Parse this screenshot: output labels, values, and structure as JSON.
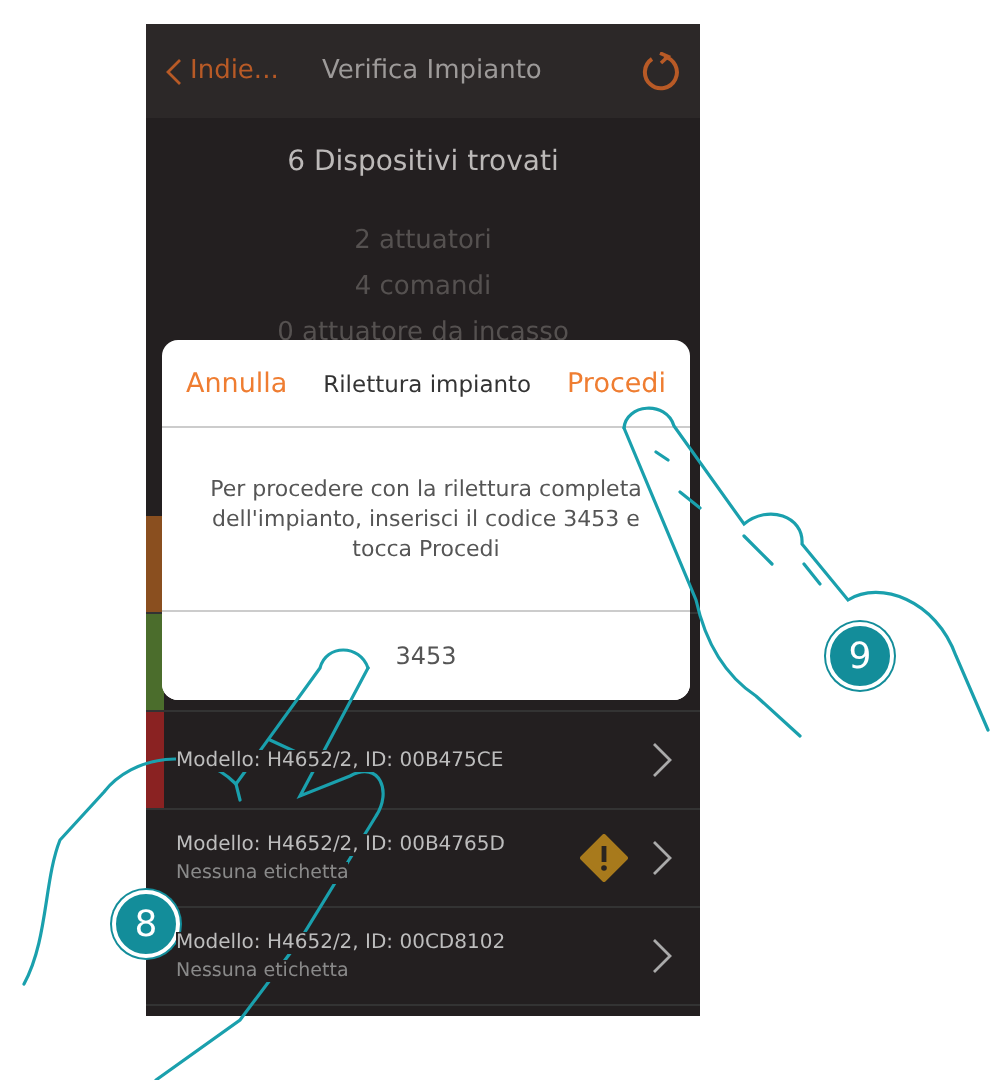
{
  "header": {
    "back_label": "Indie...",
    "title": "Verifica Impianto"
  },
  "summary": {
    "title": "6 Dispositivi trovati",
    "counts": [
      "2 attuatori",
      "4 comandi",
      "0 attuatore da incasso"
    ]
  },
  "dialog": {
    "cancel": "Annulla",
    "title": "Rilettura impianto",
    "confirm": "Procedi",
    "message": "Per procedere con la rilettura completa dell'impianto, inserisci il codice 3453 e tocca Procedi",
    "code_value": "3453"
  },
  "devices": [
    {
      "color": "#8a4f1f"
    },
    {
      "color": "#4b6d2c"
    },
    {
      "color": "#8a2222",
      "model": "Modello: H4652/2, ID: 00B475CE",
      "warning": false
    },
    {
      "model": "Modello: H4652/2, ID: 00B4765D",
      "label": "Nessuna etichetta",
      "warning": true
    },
    {
      "model": "Modello: H4652/2, ID: 00CD8102",
      "label": "Nessuna etichetta",
      "warning": false
    }
  ],
  "callouts": [
    {
      "label": "8"
    },
    {
      "label": "9"
    }
  ]
}
